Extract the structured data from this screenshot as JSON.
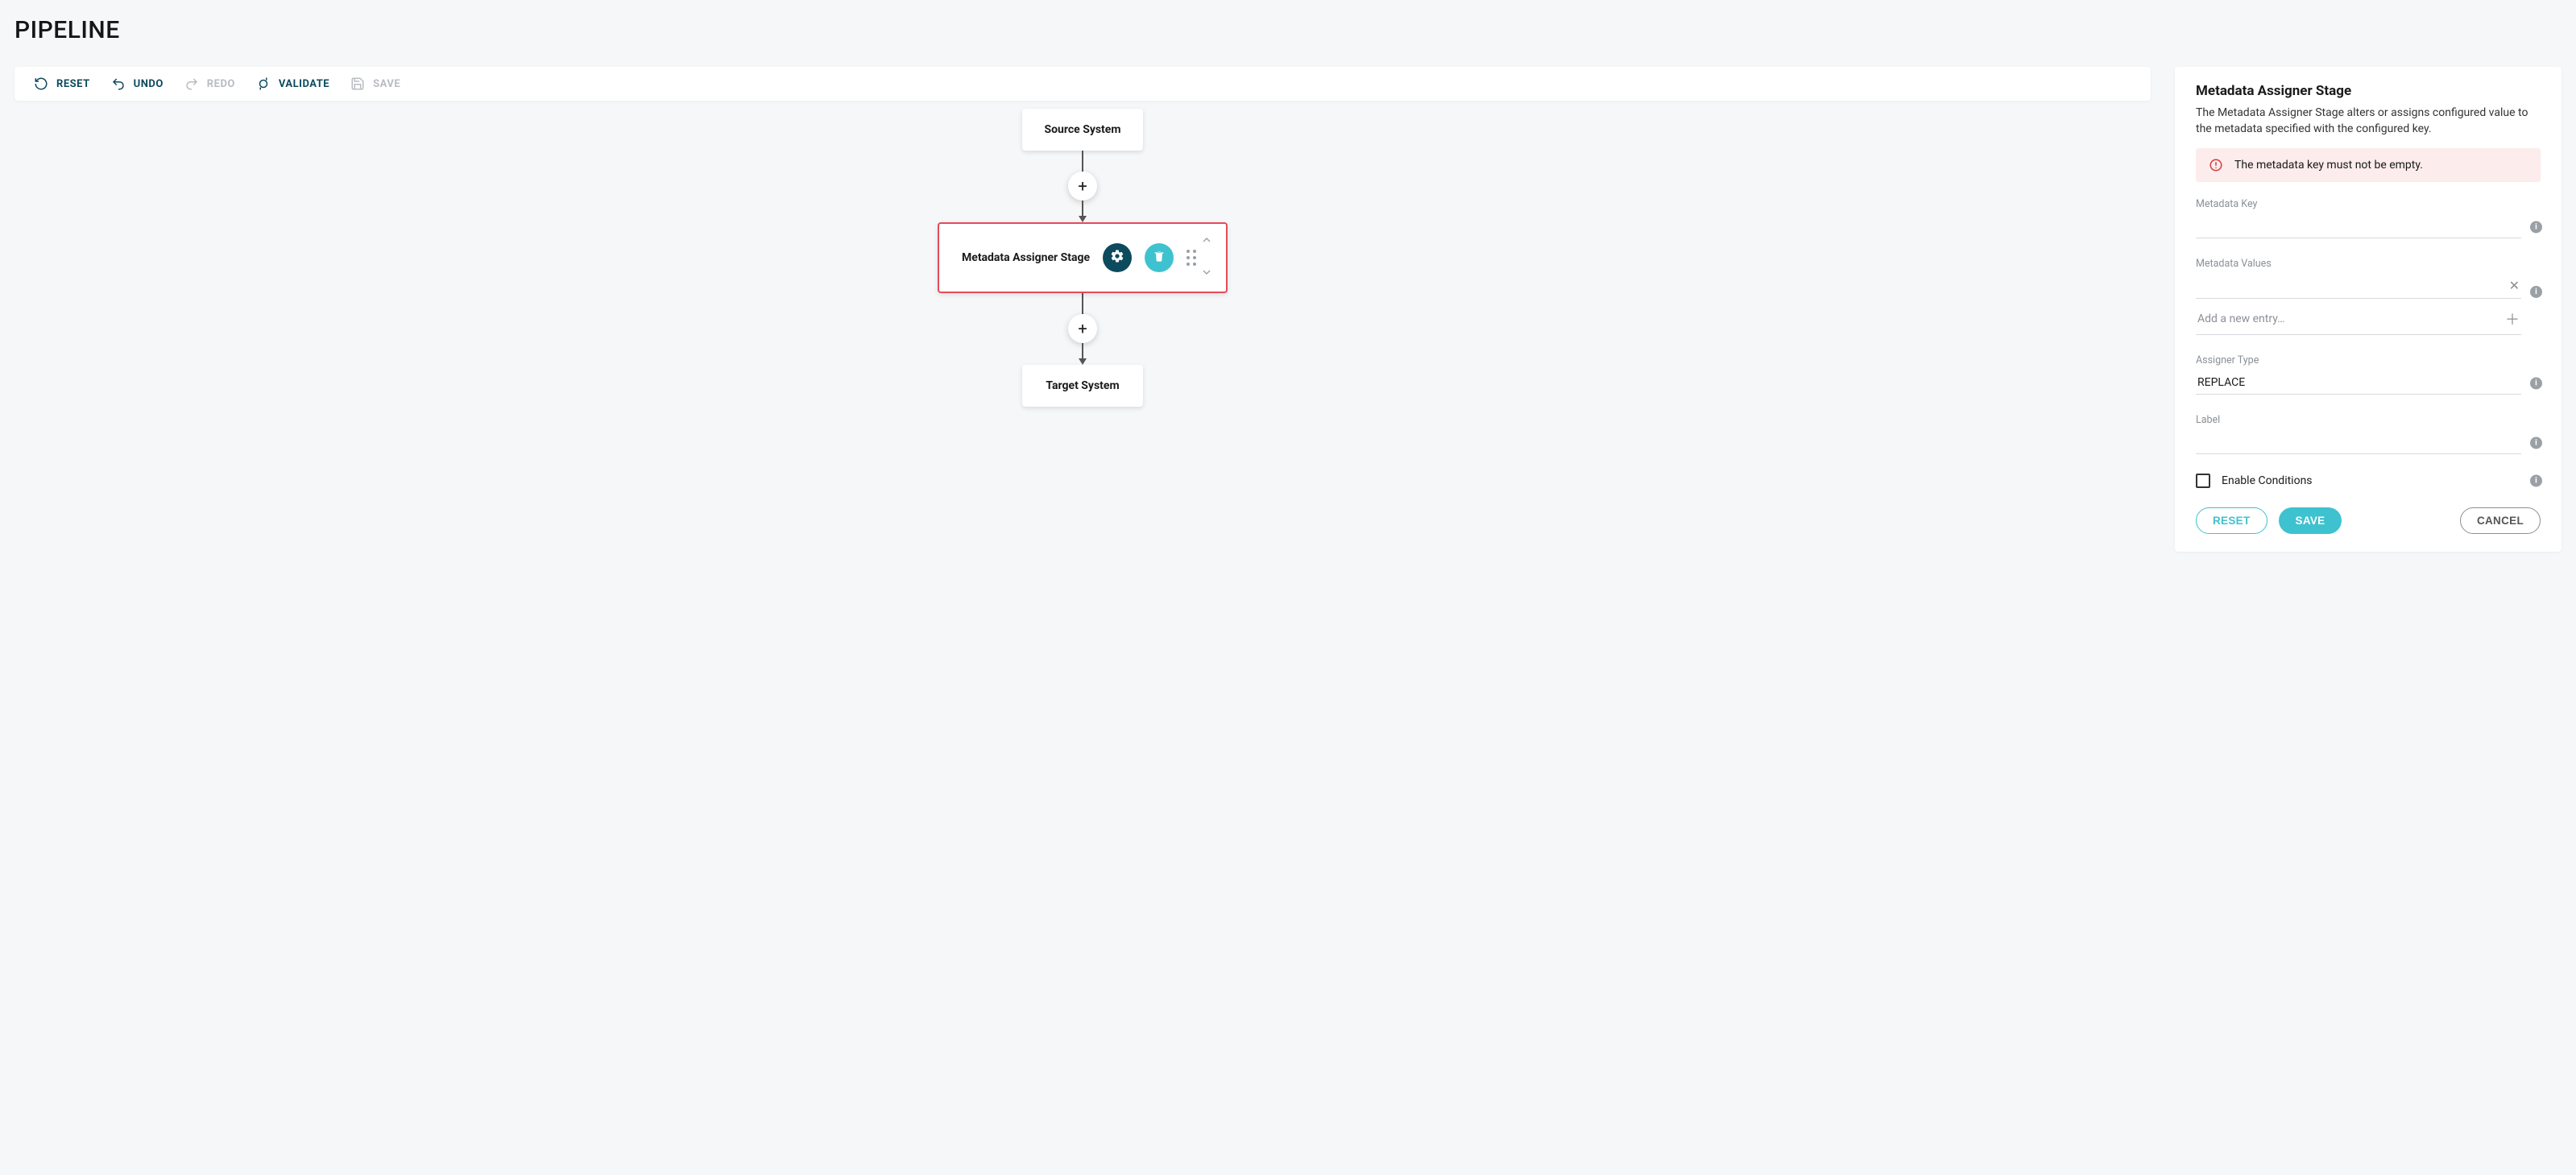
{
  "page_title": "PIPELINE",
  "toolbar": {
    "reset": {
      "label": "RESET",
      "enabled": true
    },
    "undo": {
      "label": "UNDO",
      "enabled": true
    },
    "redo": {
      "label": "REDO",
      "enabled": false
    },
    "validate": {
      "label": "VALIDATE",
      "enabled": true
    },
    "save": {
      "label": "SAVE",
      "enabled": false
    }
  },
  "flow": {
    "source_label": "Source System",
    "stage_label": "Metadata Assigner Stage",
    "target_label": "Target System"
  },
  "panel": {
    "title": "Metadata Assigner Stage",
    "description": "The Metadata Assigner Stage alters or assigns configured value to the metadata specified with the configured key.",
    "error": "The metadata key must not be empty.",
    "fields": {
      "metadata_key": {
        "label": "Metadata Key",
        "value": ""
      },
      "metadata_values": {
        "label": "Metadata Values",
        "add_entry_placeholder": "Add a new entry…"
      },
      "assigner_type": {
        "label": "Assigner Type",
        "value": "REPLACE"
      },
      "label_field": {
        "label": "Label",
        "value": ""
      },
      "enable_conditions": {
        "label": "Enable Conditions",
        "checked": false
      }
    },
    "actions": {
      "reset": "RESET",
      "save": "SAVE",
      "cancel": "CANCEL"
    }
  }
}
